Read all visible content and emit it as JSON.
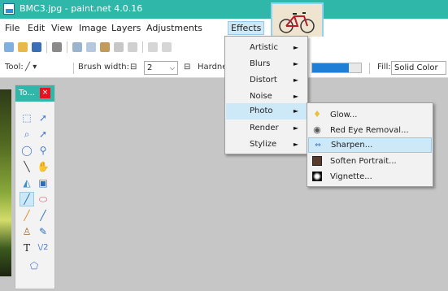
{
  "window": {
    "title": "BMC3.jpg - paint.net 4.0.16"
  },
  "menubar": {
    "items": [
      {
        "label": "File"
      },
      {
        "label": "Edit"
      },
      {
        "label": "View"
      },
      {
        "label": "Image"
      },
      {
        "label": "Layers"
      },
      {
        "label": "Adjustments"
      },
      {
        "label": "Effects"
      }
    ]
  },
  "options": {
    "tool_label": "Tool:",
    "tool_glyph": "╱ ▾",
    "brush_width_label": "Brush width:",
    "brush_width_value": "2",
    "brush_width_glyph": "⊟",
    "hardness_label": "Hardne",
    "hardness_glyph": "⊟",
    "hardness_fraction": 0.75,
    "fill_label": "Fill:",
    "fill_value": "Solid Color"
  },
  "tools_window": {
    "title": "To...",
    "close_glyph": "×"
  },
  "effects_menu": {
    "items": [
      {
        "label": "Artistic",
        "arrow": "►"
      },
      {
        "label": "Blurs",
        "arrow": "►"
      },
      {
        "label": "Distort",
        "arrow": "►"
      },
      {
        "label": "Noise",
        "arrow": "►"
      },
      {
        "label": "Photo",
        "arrow": "►"
      },
      {
        "label": "Render",
        "arrow": "►"
      },
      {
        "label": "Stylize",
        "arrow": "►"
      }
    ]
  },
  "photo_menu": {
    "items": [
      {
        "label": "Glow...",
        "icon": "lightbulb-icon"
      },
      {
        "label": "Red Eye Removal...",
        "icon": "eye-icon"
      },
      {
        "label": "Sharpen...",
        "icon": "sharpen-icon"
      },
      {
        "label": "Soften Portrait...",
        "icon": "portrait-icon"
      },
      {
        "label": "Vignette...",
        "icon": "vignette-icon"
      }
    ]
  },
  "colors": {
    "title_bar": "#2fb8a9",
    "highlight": "#cde8f7",
    "progress": "#1e7fd6",
    "workspace": "#c6c6c6"
  }
}
